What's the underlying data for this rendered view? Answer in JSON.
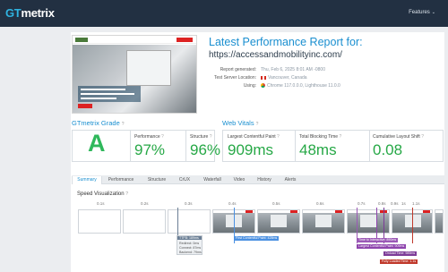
{
  "brand": {
    "logo_gt": "GT",
    "logo_rest": "metrix"
  },
  "nav": {
    "features_label": "Features",
    "features_chevron": "⌄"
  },
  "report": {
    "title": "Latest Performance Report for:",
    "url": "https://accessandmobilityinc.com/",
    "generated_label": "Report generated:",
    "generated_value": "Thu, Feb 6, 2025 8:01 AM -0800",
    "location_label": "Test Server Location:",
    "location_value": "Vancouver, Canada",
    "using_label": "Using:",
    "using_value": "Chrome 117.0.0.0, Lighthouse 11.0.0"
  },
  "grade": {
    "section_label": "GTmetrix Grade",
    "letter": "A",
    "performance_label": "Performance",
    "performance_value": "97%",
    "structure_label": "Structure",
    "structure_value": "96%"
  },
  "vitals": {
    "section_label": "Web Vitals",
    "lcp_label": "Largest Contentful Paint",
    "lcp_value": "909ms",
    "tbt_label": "Total Blocking Time",
    "tbt_value": "48ms",
    "cls_label": "Cumulative Layout Shift",
    "cls_value": "0.08"
  },
  "help_glyph": "?",
  "tabs": [
    {
      "label": "Summary",
      "active": true
    },
    {
      "label": "Performance"
    },
    {
      "label": "Structure"
    },
    {
      "label": "CrUX"
    },
    {
      "label": "Waterfall"
    },
    {
      "label": "Video"
    },
    {
      "label": "History"
    },
    {
      "label": "Alerts"
    }
  ],
  "speed": {
    "title": "Speed Visualization",
    "ticks": [
      "0.1s",
      "0.2s",
      "0.3s",
      "0.4s",
      "0.5s",
      "0.6s",
      "0.7s",
      "0.8s",
      "0.9s",
      "1s",
      "1.1s"
    ],
    "ttfb_head": "TTFB: 189ms",
    "ttfb_lines": [
      "Redirect: 0ms",
      "Connect: 87ms",
      "Backend: 79ms"
    ],
    "markers": [
      {
        "label": "First Contentful Paint: 428ms",
        "color": "#4a90e2"
      },
      {
        "label": "Time to Interactive: 890ms",
        "color": "#9b59b6"
      },
      {
        "label": "Largest Contentful Paint: 909ms",
        "color": "#8e44ad"
      },
      {
        "label": "Onload Time: 989ms",
        "color": "#7d3c98"
      },
      {
        "label": "Fully Loaded Time: 1.1s",
        "color": "#c0392b"
      }
    ]
  },
  "colors": {
    "accent": "#1a8fd0",
    "good": "#26a846",
    "topbar": "#223042"
  }
}
